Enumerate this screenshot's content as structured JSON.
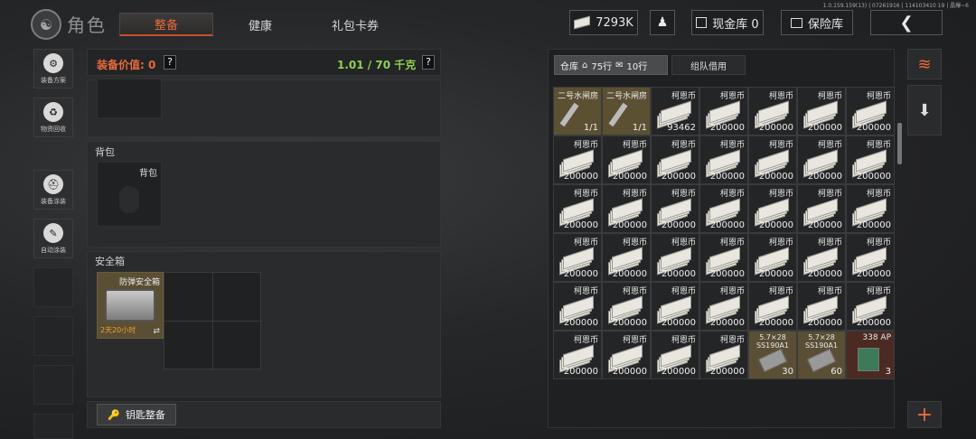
{
  "version": "1.0.159.159(13) | 07261916 | 114103410 19 | 晶爆~6",
  "header": {
    "title": "角色",
    "tabs": [
      {
        "label": "整备",
        "active": true
      },
      {
        "label": "健康",
        "active": false
      },
      {
        "label": "礼包卡券",
        "active": false
      }
    ],
    "currency": "7293K",
    "cash_label": "现金库 0",
    "vault_label": "保险库",
    "back_icon": "chevron-left-icon"
  },
  "sidebar": [
    {
      "label": "装备方案",
      "icon": "gear-plan-icon"
    },
    {
      "label": "物资回收",
      "icon": "recycle-icon"
    },
    {
      "label": "装备涂装",
      "icon": "helmet-paint-icon"
    },
    {
      "label": "自动涂装",
      "icon": "auto-paint-icon"
    }
  ],
  "equipment": {
    "value_label": "装备价值: 0",
    "weight_label": "1.01 / 70 千克",
    "help": "?",
    "backpack_title": "背包",
    "backpack_slot_label": "背包",
    "safebox_title": "安全箱",
    "safebox_item_name": "防弹安全箱",
    "safebox_timer": "2天20小时",
    "key_button_label": "钥匙整备"
  },
  "storage": {
    "tab_warehouse": "仓库",
    "rows_house": "75行",
    "rows_bag": "10行",
    "tab_team": "组队借用",
    "grid": [
      [
        {
          "name": "二号水闸房",
          "count": "1/1",
          "type": "key"
        },
        {
          "name": "二号水闸房",
          "count": "1/1",
          "type": "key"
        },
        {
          "name": "柯恩币",
          "count": "93462",
          "type": "money"
        },
        {
          "name": "柯恩币",
          "count": "200000",
          "type": "money"
        },
        {
          "name": "柯恩币",
          "count": "200000",
          "type": "money"
        },
        {
          "name": "柯恩币",
          "count": "200000",
          "type": "money"
        },
        {
          "name": "柯恩币",
          "count": "200000",
          "type": "money"
        }
      ],
      [
        {
          "name": "柯恩币",
          "count": "200000",
          "type": "money"
        },
        {
          "name": "柯恩币",
          "count": "200000",
          "type": "money"
        },
        {
          "name": "柯恩币",
          "count": "200000",
          "type": "money"
        },
        {
          "name": "柯恩币",
          "count": "200000",
          "type": "money"
        },
        {
          "name": "柯恩币",
          "count": "200000",
          "type": "money"
        },
        {
          "name": "柯恩币",
          "count": "200000",
          "type": "money"
        },
        {
          "name": "柯恩币",
          "count": "200000",
          "type": "money"
        }
      ],
      [
        {
          "name": "柯恩币",
          "count": "200000",
          "type": "money"
        },
        {
          "name": "柯恩币",
          "count": "200000",
          "type": "money"
        },
        {
          "name": "柯恩币",
          "count": "200000",
          "type": "money"
        },
        {
          "name": "柯恩币",
          "count": "200000",
          "type": "money"
        },
        {
          "name": "柯恩币",
          "count": "200000",
          "type": "money"
        },
        {
          "name": "柯恩币",
          "count": "200000",
          "type": "money"
        },
        {
          "name": "柯恩币",
          "count": "200000",
          "type": "money"
        }
      ],
      [
        {
          "name": "柯恩币",
          "count": "200000",
          "type": "money"
        },
        {
          "name": "柯恩币",
          "count": "200000",
          "type": "money"
        },
        {
          "name": "柯恩币",
          "count": "200000",
          "type": "money"
        },
        {
          "name": "柯恩币",
          "count": "200000",
          "type": "money"
        },
        {
          "name": "柯恩币",
          "count": "200000",
          "type": "money"
        },
        {
          "name": "柯恩币",
          "count": "200000",
          "type": "money"
        },
        {
          "name": "柯恩币",
          "count": "200000",
          "type": "money"
        }
      ],
      [
        {
          "name": "柯恩币",
          "count": "200000",
          "type": "money"
        },
        {
          "name": "柯恩币",
          "count": "200000",
          "type": "money"
        },
        {
          "name": "柯恩币",
          "count": "200000",
          "type": "money"
        },
        {
          "name": "柯恩币",
          "count": "200000",
          "type": "money"
        },
        {
          "name": "柯恩币",
          "count": "200000",
          "type": "money"
        },
        {
          "name": "柯恩币",
          "count": "200000",
          "type": "money"
        },
        {
          "name": "柯恩币",
          "count": "200000",
          "type": "money"
        }
      ],
      [
        {
          "name": "柯恩币",
          "count": "200000",
          "type": "money"
        },
        {
          "name": "柯恩币",
          "count": "200000",
          "type": "money"
        },
        {
          "name": "柯恩币",
          "count": "200000",
          "type": "money"
        },
        {
          "name": "柯恩币",
          "count": "200000",
          "type": "money"
        },
        {
          "name": "5.7×28 SS190A1",
          "count": "30",
          "type": "ammo"
        },
        {
          "name": "5.7×28 SS190A1",
          "count": "60",
          "type": "ammo"
        },
        {
          "name": "338 AP",
          "count": "3",
          "type": "ammo-red"
        }
      ]
    ]
  },
  "right_actions": [
    {
      "icon": "stack-sort-icon"
    },
    {
      "icon": "stack-download-icon"
    },
    {
      "icon": "plus-icon",
      "label": "+"
    }
  ],
  "colors": {
    "accent": "#e86a3c",
    "green": "#8fd14f",
    "gold": "#5c5033"
  }
}
